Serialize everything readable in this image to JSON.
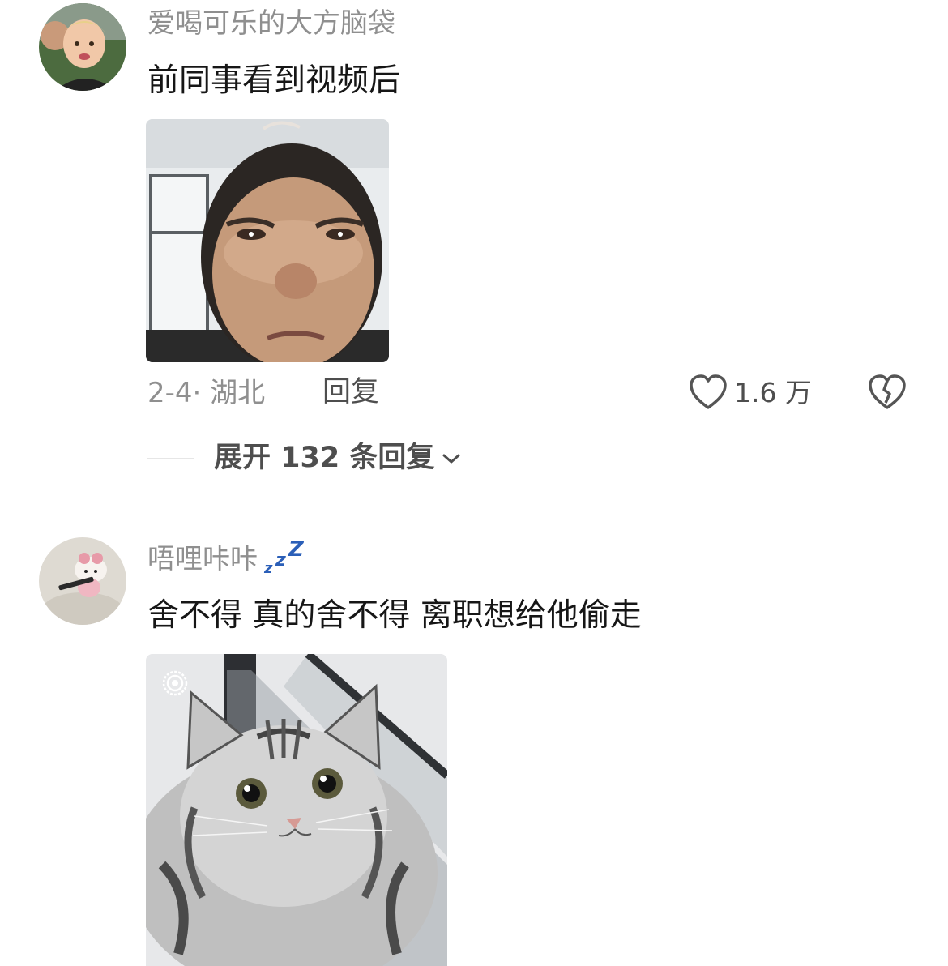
{
  "comments": [
    {
      "username": "爱喝可乐的大方脑袋",
      "text": "前同事看到视频后",
      "media": "photo-crying-man",
      "date_location": "2-4· 湖北",
      "reply_label": "回复",
      "like_count": "1.6 万",
      "expand_label": "展开 132 条回复"
    },
    {
      "username": "唔哩咔咔",
      "username_badge": "zzZ",
      "text": "舍不得 真的舍不得 离职想给他偷走",
      "media": "photo-tabby-cat"
    }
  ],
  "colors": {
    "username": "#8f8f8f",
    "text": "#161616",
    "accent_badge": "#2b5fb8"
  },
  "icons": [
    "heart-outline-icon",
    "broken-heart-icon",
    "chevron-down-icon",
    "live-photo-icon"
  ]
}
